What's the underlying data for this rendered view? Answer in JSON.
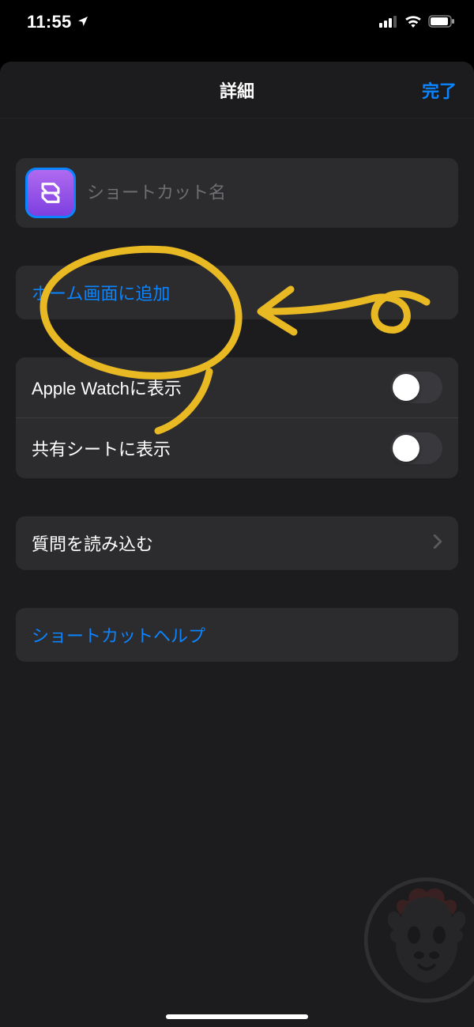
{
  "status_bar": {
    "time": "11:55"
  },
  "navbar": {
    "title": "詳細",
    "done": "完了"
  },
  "shortcut_name": {
    "placeholder": "ショートカット名"
  },
  "add_to_home": {
    "label": "ホーム画面に追加"
  },
  "toggles": {
    "apple_watch": {
      "label": "Apple Watchに表示",
      "on": false
    },
    "share_sheet": {
      "label": "共有シートに表示",
      "on": false
    }
  },
  "import_questions": {
    "label": "質問を読み込む"
  },
  "help": {
    "label": "ショートカットヘルプ"
  },
  "annotation": {
    "color": "#e8b923"
  }
}
